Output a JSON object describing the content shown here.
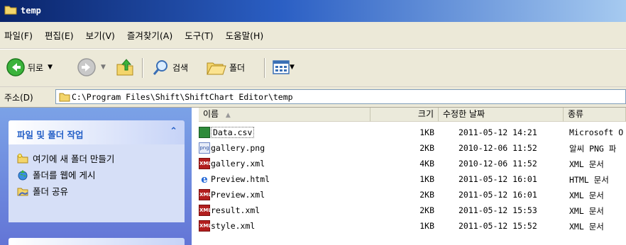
{
  "window": {
    "title": "temp"
  },
  "menu": {
    "items": [
      "파일(F)",
      "편집(E)",
      "보기(V)",
      "즐겨찾기(A)",
      "도구(T)",
      "도움말(H)"
    ]
  },
  "toolbar": {
    "back_label": "뒤로",
    "search_label": "검색",
    "folders_label": "폴더"
  },
  "address": {
    "label": "주소(D)",
    "path": "C:\\Program Files\\Shift\\ShiftChart Editor\\temp"
  },
  "tasks": {
    "title": "파일 및 폴더 작업",
    "items": [
      "여기에 새 폴더 만들기",
      "폴더를 웹에 게시",
      "폴더 공유"
    ]
  },
  "columns": {
    "name": "이름",
    "size": "크기",
    "modified": "수정한 날짜",
    "type": "종류"
  },
  "files": [
    {
      "name": "Data.csv",
      "size": "1KB",
      "modified": "2011-05-12 14:21",
      "type": "Microsoft O",
      "icon": "csv-icon"
    },
    {
      "name": "gallery.png",
      "size": "2KB",
      "modified": "2010-12-06 11:52",
      "type": "알씨 PNG 파",
      "icon": "png-icon"
    },
    {
      "name": "gallery.xml",
      "size": "4KB",
      "modified": "2010-12-06 11:52",
      "type": "XML 문서",
      "icon": "xml-icon"
    },
    {
      "name": "Preview.html",
      "size": "1KB",
      "modified": "2011-05-12 16:01",
      "type": "HTML 문서",
      "icon": "html-icon"
    },
    {
      "name": "Preview.xml",
      "size": "2KB",
      "modified": "2011-05-12 16:01",
      "type": "XML 문서",
      "icon": "xml-icon"
    },
    {
      "name": "result.xml",
      "size": "2KB",
      "modified": "2011-05-12 15:53",
      "type": "XML 문서",
      "icon": "xml-icon"
    },
    {
      "name": "style.xml",
      "size": "1KB",
      "modified": "2011-05-12 15:52",
      "type": "XML 문서",
      "icon": "xml-icon"
    }
  ]
}
